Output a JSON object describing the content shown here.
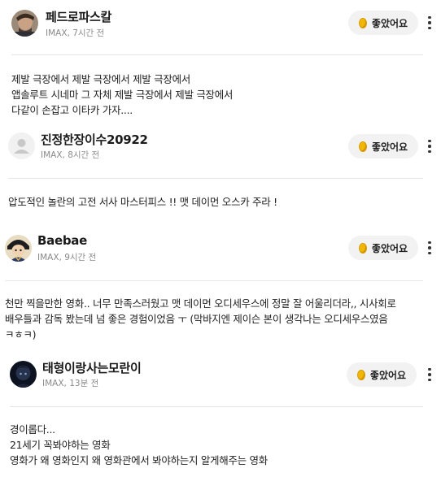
{
  "like_label": "좋았어요",
  "coin_color": "#f2b705",
  "reviews": [
    {
      "username": "페드로파스칼",
      "meta": "IMAX, 7시간 전",
      "avatar": "photo-avatar",
      "body": [
        "제발 극장에서 제발 극장에서 제발 극장에서",
        "앱솔루트 시네마 그 자체 제발 극장에서 제발 극장에서",
        "다같이 손잡고 이타카 가자...."
      ]
    },
    {
      "username": "진정한장이수20922",
      "meta": "IMAX, 8시간 전",
      "avatar": "default-user-icon",
      "body": [
        "압도적인 놀란의 고전 서사 마스터피스 !! 맷 데이먼 오스카 주라 !"
      ]
    },
    {
      "username": "Baebae",
      "meta": "IMAX, 9시간 전",
      "avatar": "character-avatar",
      "body": [
        "천만 찍을만한 영화.. 너무 만족스러웠고 맷 데이먼 오디세우스에 정말 잘 어울리더라,, 시사회로",
        "배우들과 감독 봤는데 넘 좋은 경험이었음 ㅜ (막바지엔 제이슨 본이 생각나는 오디세우스였음",
        "ㅋㅎㅋ)"
      ]
    },
    {
      "username": "태형이랑사는모란이",
      "meta": "IMAX, 13분 전",
      "avatar": "dark-photo-avatar",
      "body": [
        "경이롭다...",
        "21세기 꼭봐야하는 영화",
        "영화가 왜 영화인지 왜 영화관에서 봐야하는지 알게해주는 영화"
      ]
    }
  ]
}
